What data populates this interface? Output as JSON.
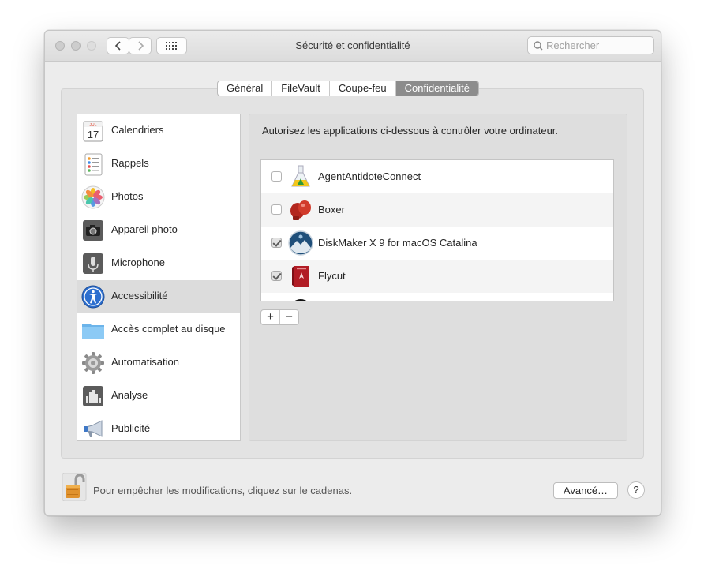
{
  "window": {
    "title": "Sécurité et confidentialité"
  },
  "toolbar": {
    "search_placeholder": "Rechercher"
  },
  "tabs": [
    {
      "label": "Général",
      "active": false
    },
    {
      "label": "FileVault",
      "active": false
    },
    {
      "label": "Coupe-feu",
      "active": false
    },
    {
      "label": "Confidentialité",
      "active": true
    }
  ],
  "sidebar": {
    "items": [
      {
        "label": "Calendriers",
        "icon": "calendar-icon",
        "calendar_month": "JUL",
        "calendar_day": "17"
      },
      {
        "label": "Rappels",
        "icon": "reminders-icon"
      },
      {
        "label": "Photos",
        "icon": "photos-icon"
      },
      {
        "label": "Appareil photo",
        "icon": "camera-icon"
      },
      {
        "label": "Microphone",
        "icon": "microphone-icon"
      },
      {
        "label": "Accessibilité",
        "icon": "accessibility-icon",
        "selected": true
      },
      {
        "label": "Accès complet au disque",
        "icon": "folder-icon"
      },
      {
        "label": "Automatisation",
        "icon": "gear-icon"
      },
      {
        "label": "Analyse",
        "icon": "analytics-icon"
      },
      {
        "label": "Publicité",
        "icon": "megaphone-icon"
      }
    ]
  },
  "main": {
    "instruction": "Autorisez les applications ci-dessous à contrôler votre ordinateur.",
    "apps": [
      {
        "name": "AgentAntidoteConnect",
        "checked": false,
        "icon": "antidote-flask-icon"
      },
      {
        "name": "Boxer",
        "checked": false,
        "icon": "boxing-gloves-icon"
      },
      {
        "name": "DiskMaker X 9 for macOS Catalina",
        "checked": true,
        "icon": "diskmaker-icon"
      },
      {
        "name": "Flycut",
        "checked": true,
        "icon": "flycut-icon"
      }
    ],
    "add_label": "+",
    "remove_label": "−"
  },
  "footer": {
    "lock_message": "Pour empêcher les modifications, cliquez sur le cadenas.",
    "advanced_label": "Avancé…",
    "help_label": "?"
  }
}
